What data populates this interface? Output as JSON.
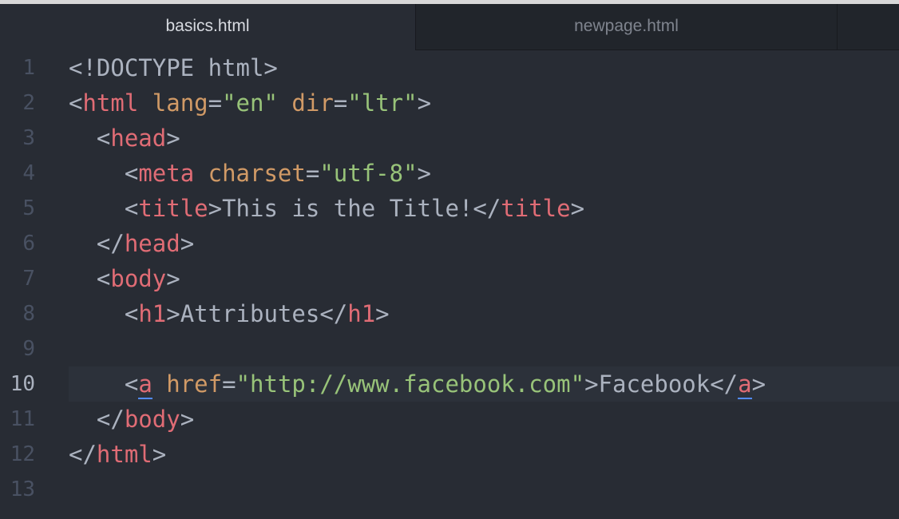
{
  "tabs": [
    {
      "label": "basics.html",
      "active": true
    },
    {
      "label": "newpage.html",
      "active": false
    }
  ],
  "editor": {
    "current_line": 10,
    "lines": [
      {
        "num": "1",
        "indent": "",
        "tokens": [
          [
            "punct",
            "<!DOCTYPE html>"
          ]
        ]
      },
      {
        "num": "2",
        "indent": "",
        "tokens": [
          [
            "punct",
            "<"
          ],
          [
            "tag",
            "html"
          ],
          [
            "punct",
            " "
          ],
          [
            "attr",
            "lang"
          ],
          [
            "punct",
            "="
          ],
          [
            "str",
            "\"en\""
          ],
          [
            "punct",
            " "
          ],
          [
            "attr",
            "dir"
          ],
          [
            "punct",
            "="
          ],
          [
            "str",
            "\"ltr\""
          ],
          [
            "punct",
            ">"
          ]
        ]
      },
      {
        "num": "3",
        "indent": "  ",
        "tokens": [
          [
            "punct",
            "<"
          ],
          [
            "tag",
            "head"
          ],
          [
            "punct",
            ">"
          ]
        ]
      },
      {
        "num": "4",
        "indent": "    ",
        "tokens": [
          [
            "punct",
            "<"
          ],
          [
            "tag",
            "meta"
          ],
          [
            "punct",
            " "
          ],
          [
            "attr",
            "charset"
          ],
          [
            "punct",
            "="
          ],
          [
            "str",
            "\"utf-8\""
          ],
          [
            "punct",
            ">"
          ]
        ]
      },
      {
        "num": "5",
        "indent": "    ",
        "tokens": [
          [
            "punct",
            "<"
          ],
          [
            "tag",
            "title"
          ],
          [
            "punct",
            ">"
          ],
          [
            "text",
            "This is the Title!"
          ],
          [
            "punct",
            "</"
          ],
          [
            "tag",
            "title"
          ],
          [
            "punct",
            ">"
          ]
        ]
      },
      {
        "num": "6",
        "indent": "  ",
        "tokens": [
          [
            "punct",
            "</"
          ],
          [
            "tag",
            "head"
          ],
          [
            "punct",
            ">"
          ]
        ]
      },
      {
        "num": "7",
        "indent": "  ",
        "tokens": [
          [
            "punct",
            "<"
          ],
          [
            "tag",
            "body"
          ],
          [
            "punct",
            ">"
          ]
        ]
      },
      {
        "num": "8",
        "indent": "    ",
        "tokens": [
          [
            "punct",
            "<"
          ],
          [
            "tag",
            "h1"
          ],
          [
            "punct",
            ">"
          ],
          [
            "text",
            "Attributes"
          ],
          [
            "punct",
            "</"
          ],
          [
            "tag",
            "h1"
          ],
          [
            "punct",
            ">"
          ]
        ]
      },
      {
        "num": "9",
        "indent": "",
        "tokens": []
      },
      {
        "num": "10",
        "indent": "    ",
        "tokens": [
          [
            "punct",
            "<"
          ],
          [
            "tagm",
            "a"
          ],
          [
            "punct",
            " "
          ],
          [
            "attr",
            "href"
          ],
          [
            "punct",
            "="
          ],
          [
            "str",
            "\"http://www.facebook.com\""
          ],
          [
            "punct",
            ">"
          ],
          [
            "text",
            "Facebook"
          ],
          [
            "punct",
            "</"
          ],
          [
            "tagm",
            "a"
          ],
          [
            "punct",
            ">"
          ]
        ]
      },
      {
        "num": "11",
        "indent": "  ",
        "tokens": [
          [
            "punct",
            "</"
          ],
          [
            "tag",
            "body"
          ],
          [
            "punct",
            ">"
          ]
        ]
      },
      {
        "num": "12",
        "indent": "",
        "tokens": [
          [
            "punct",
            "</"
          ],
          [
            "tag",
            "html"
          ],
          [
            "punct",
            ">"
          ]
        ]
      },
      {
        "num": "13",
        "indent": "",
        "tokens": []
      }
    ]
  },
  "colors": {
    "background": "#282c34",
    "tag": "#e06c75",
    "attribute": "#d19a66",
    "string": "#98c379",
    "text": "#abb2bf",
    "line_number": "#495162",
    "bracket_match_underline": "#528bff"
  }
}
